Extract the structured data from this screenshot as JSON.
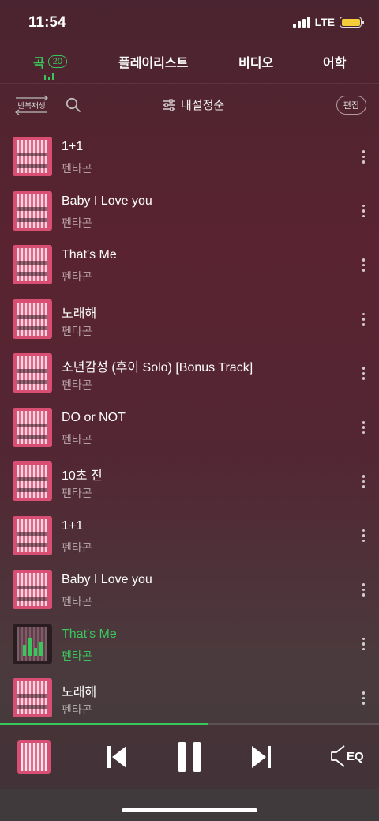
{
  "status_bar": {
    "time": "11:54",
    "network": "LTE",
    "battery_color": "#f4cd3a"
  },
  "tabs": [
    {
      "label": "곡",
      "count": "20",
      "active": true
    },
    {
      "label": "플레이리스트"
    },
    {
      "label": "비디오"
    },
    {
      "label": "어학"
    }
  ],
  "toolbar": {
    "repeat_label": "반복재생",
    "search_icon": "search-icon",
    "sort_label": "내설정순",
    "edit_label": "편집"
  },
  "songs": [
    {
      "title": "1+1",
      "artist": "펜타곤"
    },
    {
      "title": "Baby I Love you",
      "artist": "펜타곤"
    },
    {
      "title": "That's Me",
      "artist": "펜타곤"
    },
    {
      "title": "노래해",
      "artist": "펜타곤"
    },
    {
      "title": "소년감성 (후이 Solo) [Bonus Track]",
      "artist": "펜타곤"
    },
    {
      "title": "DO or NOT",
      "artist": "펜타곤"
    },
    {
      "title": "10초 전",
      "artist": "펜타곤"
    },
    {
      "title": "1+1",
      "artist": "펜타곤"
    },
    {
      "title": "Baby I Love you",
      "artist": "펜타곤"
    },
    {
      "title": "That's Me",
      "artist": "펜타곤",
      "playing": true
    },
    {
      "title": "노래해",
      "artist": "펜타곤"
    }
  ],
  "player": {
    "progress": 0.55,
    "eq_label": "EQ",
    "accent_color": "#38c75b"
  }
}
